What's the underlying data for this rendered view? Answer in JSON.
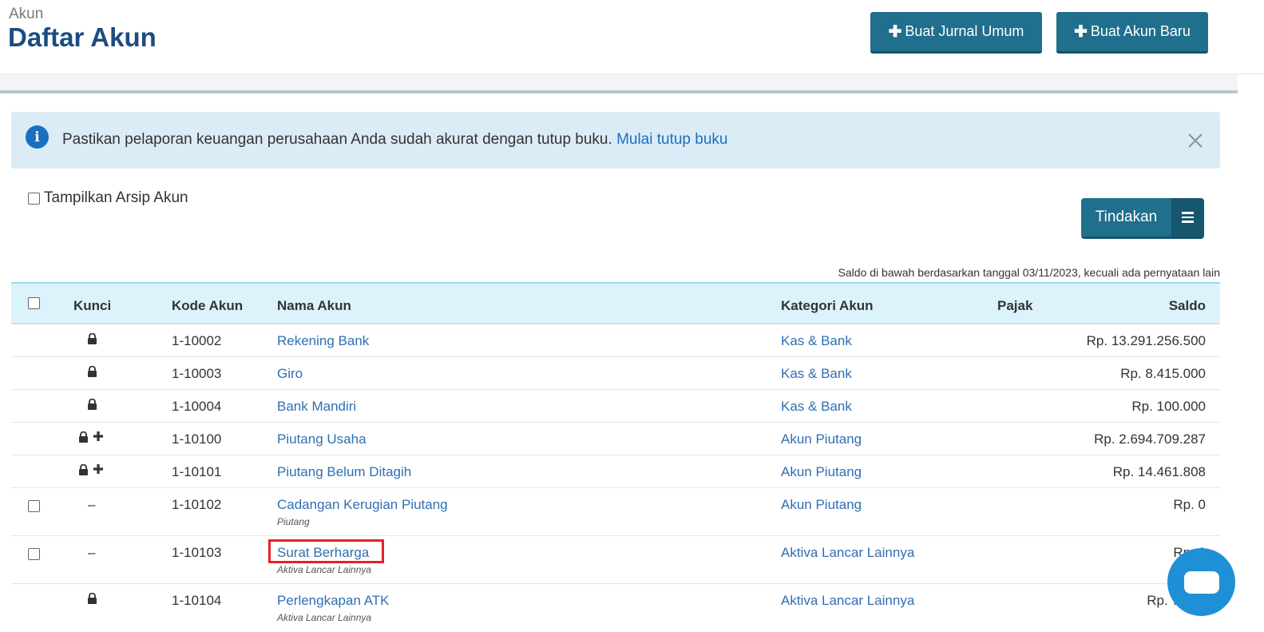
{
  "header": {
    "breadcrumb": "Akun",
    "title": "Daftar Akun",
    "btn_jurnal": "Buat Jurnal Umum",
    "btn_akun": "Buat Akun Baru"
  },
  "alert": {
    "text": "Pastikan pelaporan keuangan perusahaan Anda sudah akurat dengan tutup buku.",
    "link": "Mulai tutup buku",
    "icon": "info-icon"
  },
  "archive_label": "Tampilkan Arsip Akun",
  "tindakan_label": "Tindakan",
  "note": "Saldo di bawah berdasarkan tanggal 03/11/2023, kecuali ada pernyataan lain",
  "columns": {
    "kunci": "Kunci",
    "kode": "Kode Akun",
    "nama": "Nama Akun",
    "kategori": "Kategori Akun",
    "pajak": "Pajak",
    "saldo": "Saldo"
  },
  "rows": [
    {
      "kode": "1-10002",
      "nama": "Rekening Bank",
      "kategori": "Kas & Bank",
      "saldo": "Rp. 13.291.256.500",
      "sub": "",
      "kunci": "lock"
    },
    {
      "kode": "1-10003",
      "nama": "Giro",
      "kategori": "Kas & Bank",
      "saldo": "Rp. 8.415.000",
      "sub": "",
      "kunci": "lock"
    },
    {
      "kode": "1-10004",
      "nama": "Bank Mandiri",
      "kategori": "Kas & Bank",
      "saldo": "Rp. 100.000",
      "sub": "",
      "kunci": "lock"
    },
    {
      "kode": "1-10100",
      "nama": "Piutang Usaha",
      "kategori": "Akun Piutang",
      "saldo": "Rp. 2.694.709.287",
      "sub": "",
      "kunci": "lock-plus"
    },
    {
      "kode": "1-10101",
      "nama": "Piutang Belum Ditagih",
      "kategori": "Akun Piutang",
      "saldo": "Rp. 14.461.808",
      "sub": "",
      "kunci": "lock-plus"
    },
    {
      "kode": "1-10102",
      "nama": "Cadangan Kerugian Piutang",
      "kategori": "Akun Piutang",
      "saldo": "Rp. 0",
      "sub": "Piutang",
      "kunci": "dash"
    },
    {
      "kode": "1-10103",
      "nama": "Surat Berharga",
      "kategori": "Aktiva Lancar Lainnya",
      "saldo": "Rp. 0",
      "sub": "Aktiva Lancar Lainnya",
      "kunci": "dash"
    },
    {
      "kode": "1-10104",
      "nama": "Perlengkapan ATK",
      "kategori": "Aktiva Lancar Lainnya",
      "saldo": "Rp. 7.300",
      "sub": "Aktiva Lancar Lainnya",
      "kunci": "lock"
    }
  ],
  "dash": "–"
}
